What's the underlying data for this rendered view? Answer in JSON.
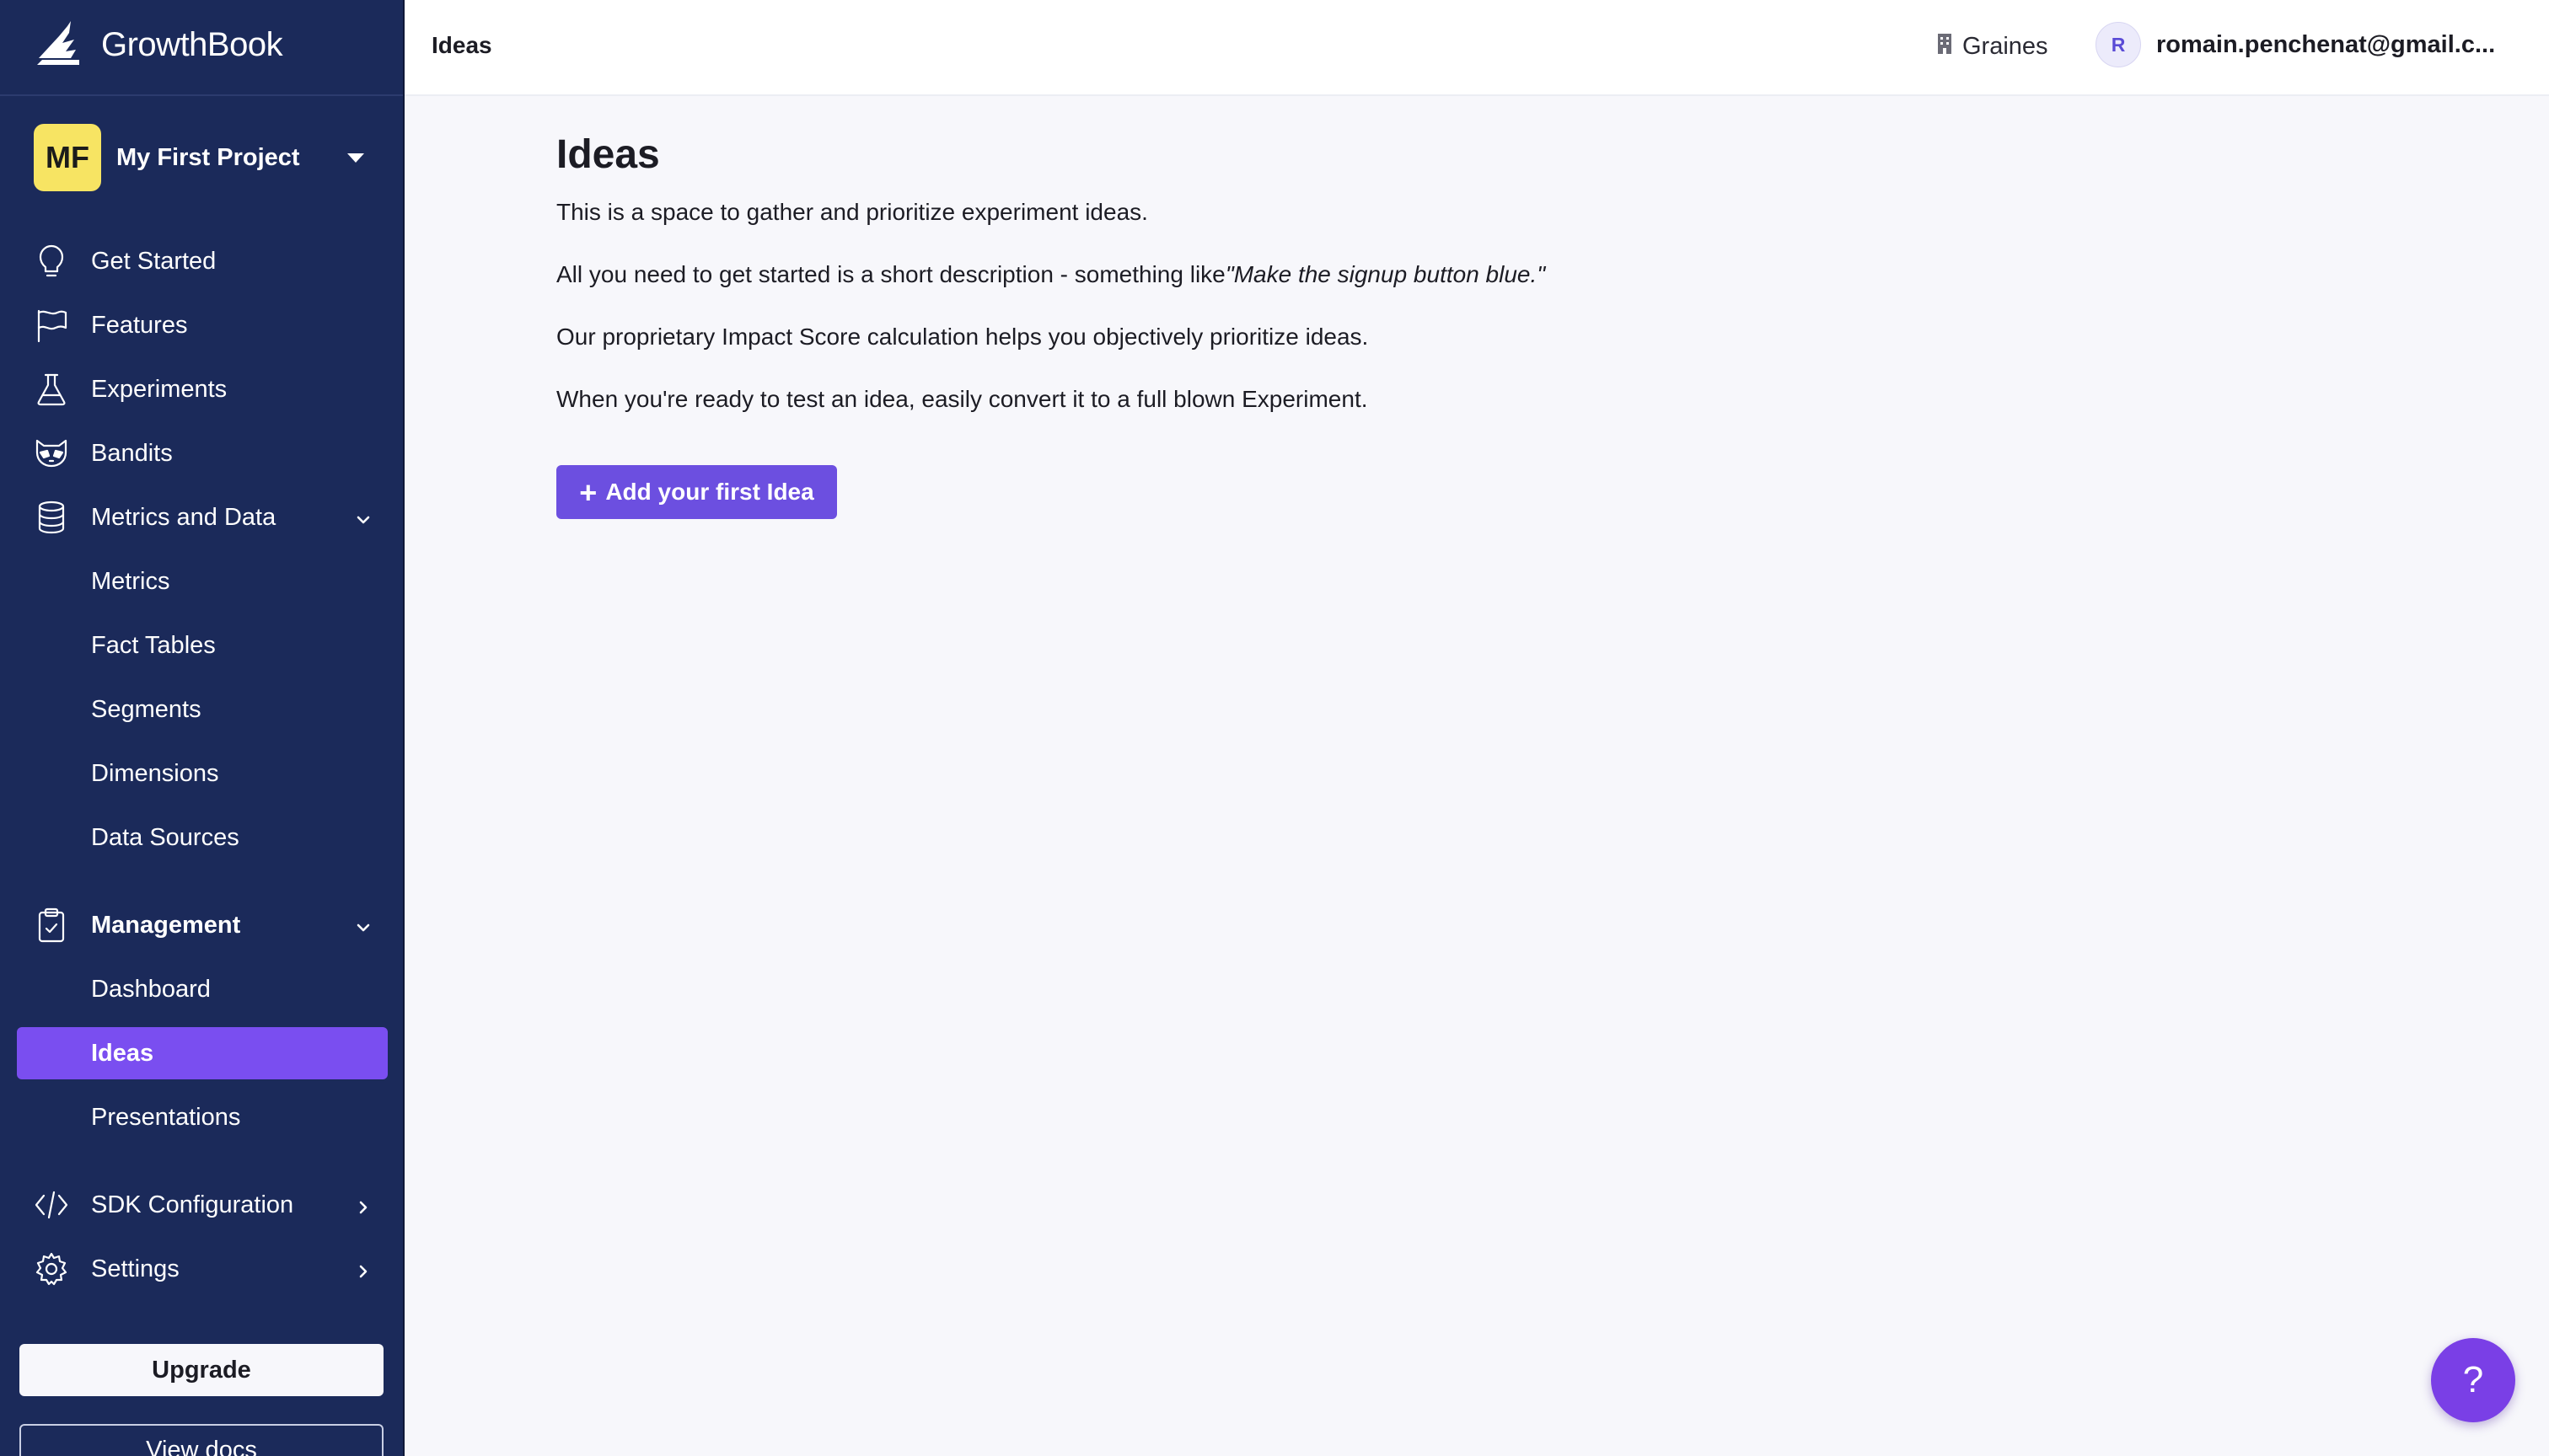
{
  "app": {
    "name": "GrowthBook"
  },
  "project": {
    "initials": "MF",
    "name": "My First Project"
  },
  "nav": {
    "get_started": "Get Started",
    "features": "Features",
    "experiments": "Experiments",
    "bandits": "Bandits",
    "metrics_and_data": "Metrics and Data",
    "metrics": "Metrics",
    "fact_tables": "Fact Tables",
    "segments": "Segments",
    "dimensions": "Dimensions",
    "data_sources": "Data Sources",
    "management": "Management",
    "dashboard": "Dashboard",
    "ideas": "Ideas",
    "presentations": "Presentations",
    "sdk_configuration": "SDK Configuration",
    "settings": "Settings"
  },
  "sidebar_buttons": {
    "upgrade": "Upgrade",
    "view_docs": "View docs"
  },
  "topbar": {
    "breadcrumb": "Ideas",
    "org": "Graines",
    "user_initial": "R",
    "user_email": "romain.penchenat@gmail.c..."
  },
  "main": {
    "title": "Ideas",
    "p1": "This is a space to gather and prioritize experiment ideas.",
    "p2_prefix": "All you need to get started is a short description - something like",
    "p2_quote": "\"Make the signup button blue.\"",
    "p3": "Our proprietary Impact Score calculation helps you objectively prioritize ideas.",
    "p4": "When you're ready to test an idea, easily convert it to a full blown Experiment.",
    "cta_plus": "+",
    "cta_label": "Add your first Idea"
  },
  "help": {
    "label": "?"
  },
  "colors": {
    "sidebar_bg": "#1b2a5a",
    "accent": "#7a4ef0",
    "cta": "#6c4fe0",
    "project_badge": "#f7e463"
  },
  "icons": [
    "growthbook-logo-icon",
    "lightbulb-icon",
    "flag-icon",
    "flask-icon",
    "raccoon-icon",
    "database-icon",
    "clipboard-check-icon",
    "code-icon",
    "gear-icon",
    "building-icon",
    "chevron-down-icon",
    "chevron-right-icon"
  ]
}
